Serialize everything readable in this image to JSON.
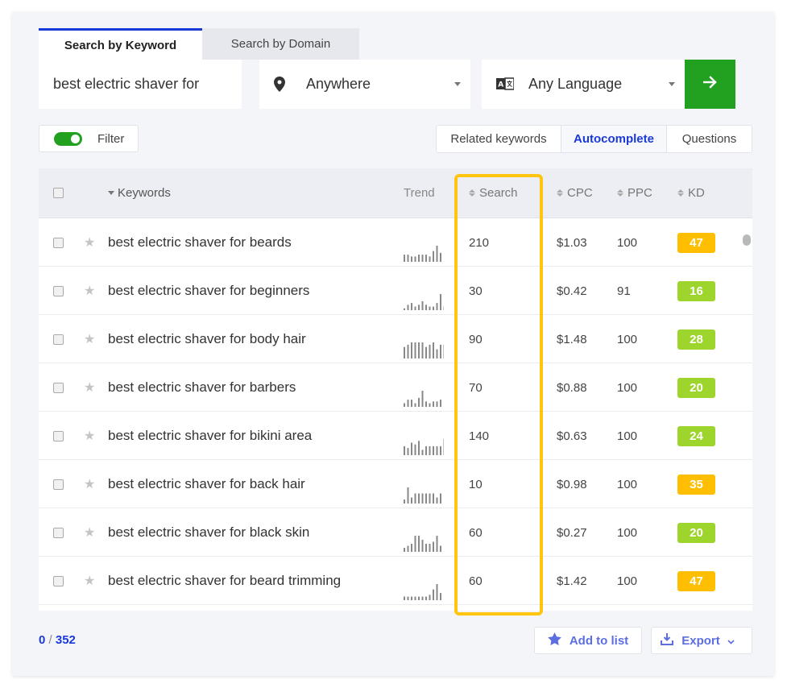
{
  "tabs": [
    {
      "label": "Search by Keyword",
      "active": true
    },
    {
      "label": "Search by Domain",
      "active": false
    }
  ],
  "search": {
    "keyword_value": "best electric shaver for",
    "location": "Anywhere",
    "language": "Any Language",
    "go_icon": "arrow-right-icon"
  },
  "filter": {
    "label": "Filter",
    "enabled": true
  },
  "modes": [
    "Related keywords",
    "Autocomplete",
    "Questions"
  ],
  "active_mode": "Autocomplete",
  "table": {
    "headers": {
      "keywords": "Keywords",
      "trend": "Trend",
      "search": "Search",
      "cpc": "CPC",
      "ppc": "PPC",
      "kd": "KD"
    },
    "rows": [
      {
        "keyword": "best electric shaver for beards",
        "search": "210",
        "cpc": "$1.03",
        "ppc": "100",
        "kd": "47",
        "kd_color": "#ffbe00",
        "trend": [
          4,
          4,
          3,
          3,
          4,
          4,
          4,
          3,
          6,
          9,
          5
        ]
      },
      {
        "keyword": "best electric shaver for beginners",
        "search": "30",
        "cpc": "$0.42",
        "ppc": "91",
        "kd": "16",
        "kd_color": "#9ed52d",
        "trend": [
          1,
          3,
          4,
          2,
          3,
          5,
          3,
          2,
          2,
          4,
          9,
          2
        ]
      },
      {
        "keyword": "best electric shaver for body hair",
        "search": "90",
        "cpc": "$1.48",
        "ppc": "100",
        "kd": "28",
        "kd_color": "#9ed52d",
        "trend": [
          5,
          6,
          7,
          7,
          7,
          7,
          5,
          6,
          7,
          4,
          6,
          6
        ]
      },
      {
        "keyword": "best electric shaver for barbers",
        "search": "70",
        "cpc": "$0.88",
        "ppc": "100",
        "kd": "20",
        "kd_color": "#9ed52d",
        "trend": [
          2,
          4,
          4,
          2,
          5,
          9,
          3,
          2,
          3,
          3,
          4
        ]
      },
      {
        "keyword": "best electric shaver for bikini area",
        "search": "140",
        "cpc": "$0.63",
        "ppc": "100",
        "kd": "24",
        "kd_color": "#9ed52d",
        "trend": [
          5,
          4,
          7,
          6,
          8,
          3,
          5,
          5,
          5,
          5,
          5,
          9
        ]
      },
      {
        "keyword": "best electric shaver for back hair",
        "search": "10",
        "cpc": "$0.98",
        "ppc": "100",
        "kd": "35",
        "kd_color": "#ffbe00",
        "trend": [
          2,
          8,
          3,
          5,
          5,
          5,
          5,
          5,
          5,
          3,
          5
        ]
      },
      {
        "keyword": "best electric shaver for black skin",
        "search": "60",
        "cpc": "$0.27",
        "ppc": "100",
        "kd": "20",
        "kd_color": "#9ed52d",
        "trend": [
          2,
          3,
          4,
          8,
          8,
          6,
          4,
          4,
          5,
          8,
          3
        ]
      },
      {
        "keyword": "best electric shaver for beard trimming",
        "search": "60",
        "cpc": "$1.42",
        "ppc": "100",
        "kd": "47",
        "kd_color": "#ffbe00",
        "trend": [
          2,
          2,
          2,
          2,
          2,
          2,
          2,
          3,
          6,
          9,
          4
        ]
      }
    ]
  },
  "footer": {
    "selected": "0",
    "total": "352",
    "add_to_list": "Add to list",
    "export": "Export"
  },
  "colors": {
    "accent": "#1a3ad8",
    "go_button": "#21a11f",
    "highlight": "#ffc50f"
  }
}
